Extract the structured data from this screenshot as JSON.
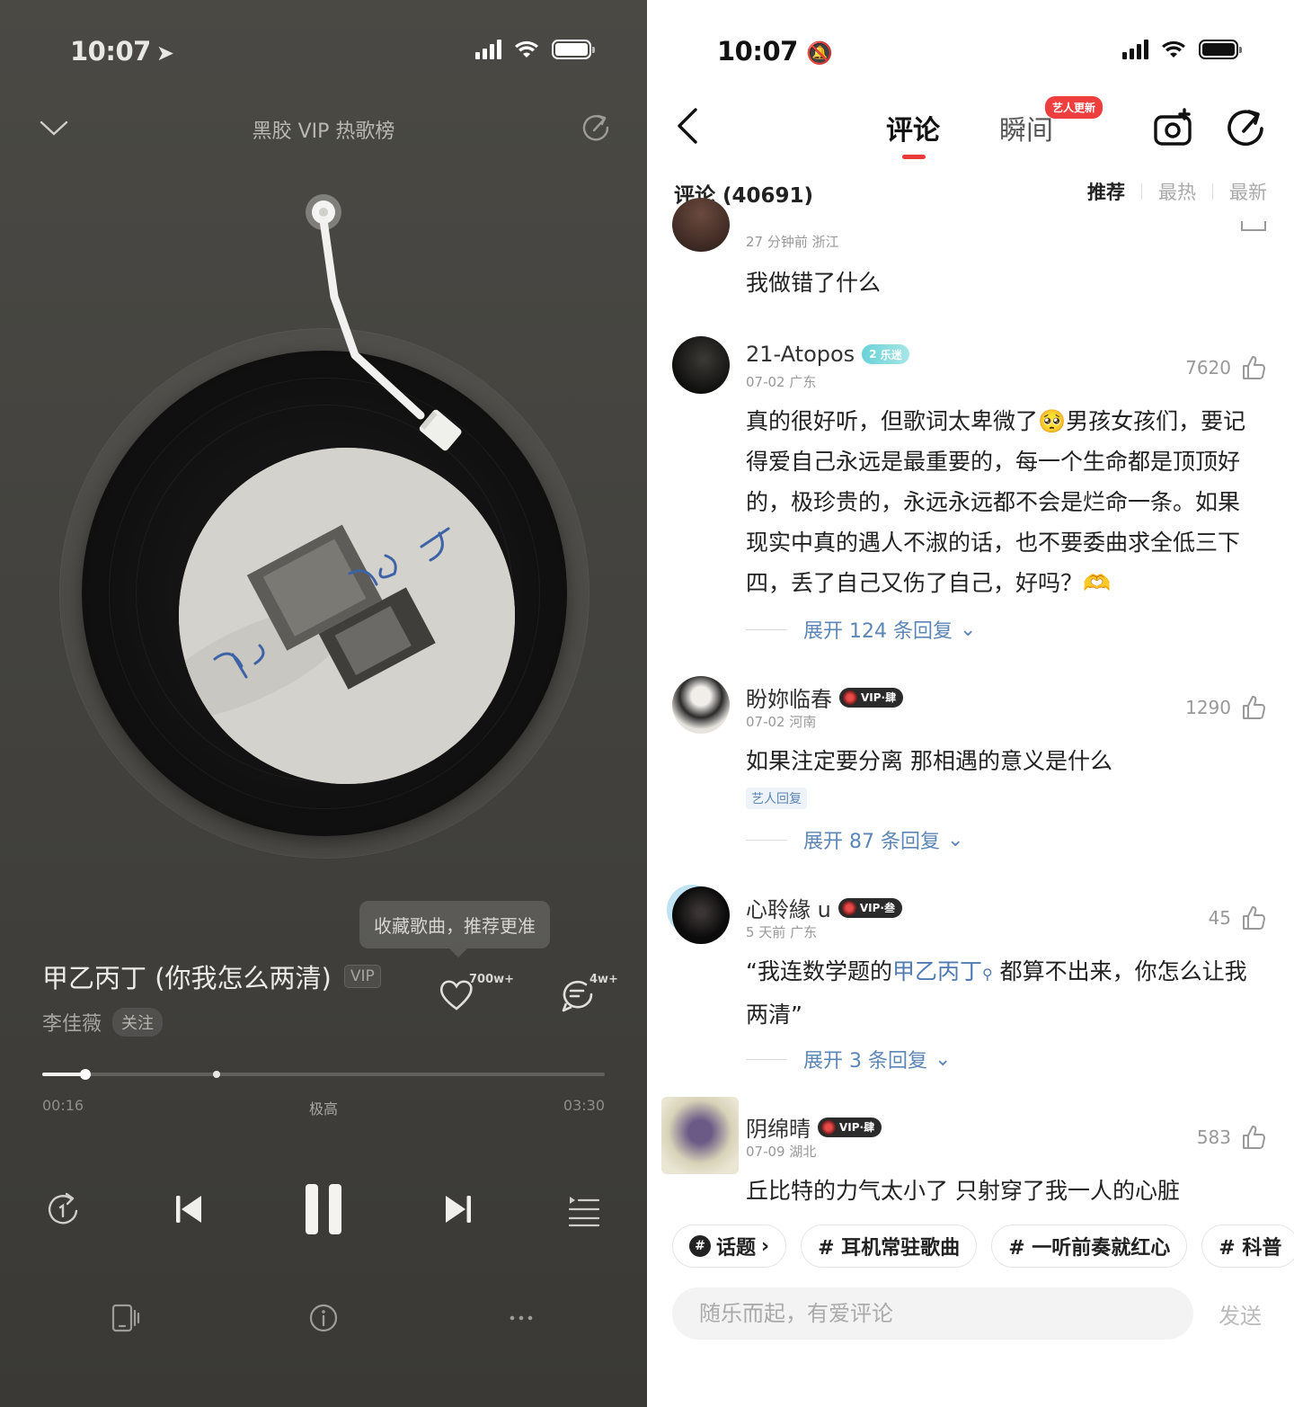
{
  "player": {
    "status": {
      "time": "10:07"
    },
    "header": {
      "title": "黑胶 VIP 热歌榜"
    },
    "tooltip": "收藏歌曲，推荐更准",
    "song": {
      "title": "甲乙丙丁 (你我怎么两清)",
      "vip_badge": "VIP",
      "artist": "李佳薇",
      "follow_label": "关注"
    },
    "like_count": "700w+",
    "comment_count": "4w+",
    "progress": {
      "current": "00:16",
      "total": "03:30",
      "quality": "极高",
      "played_fraction": 0.076,
      "buffered_fraction": 0.31
    },
    "cover_text": "甲乙丙丁",
    "colors": {
      "bg": "#45443f",
      "accent": "#ffffff"
    }
  },
  "comments_page": {
    "status": {
      "time": "10:07"
    },
    "tabs": {
      "active": "评论",
      "other": "瞬间",
      "badge": "艺人更新"
    },
    "header": {
      "count_label": "评论 (40691)",
      "sorts": [
        "推荐",
        "最热",
        "最新"
      ]
    },
    "top_partial": {
      "meta": "27 分钟前 浙江",
      "text": "我做错了什么"
    },
    "items": [
      {
        "user": "21-Atopos",
        "badge": "乐迷",
        "badge_level": "2",
        "meta": "07-02 广东",
        "likes": "7620",
        "text": "真的很好听，但歌词太卑微了🥺男孩女孩们，要记得爱自己永远是最重要的，每一个生命都是顶顶好的，极珍贵的，永远永远都不会是烂命一条。如果现实中真的遇人不淑的话，也不要委曲求全低三下四，丢了自己又伤了自己，好吗？🫶",
        "expand": "展开 124 条回复"
      },
      {
        "user": "盼妳临春",
        "badge": "VIP·肆",
        "meta": "07-02 河南",
        "likes": "1290",
        "text": "如果注定要分离 那相遇的意义是什么",
        "artist_reply": "艺人回复",
        "expand": "展开 87 条回复"
      },
      {
        "user": "心聆緣 u",
        "badge": "VIP·叁",
        "meta": "5 天前 广东",
        "likes": "45",
        "text_pre": "“我连数学题的",
        "text_link": "甲乙丙丁",
        "text_post": " 都算不出来，你怎么让我两清”",
        "expand": "展开 3 条回复"
      },
      {
        "user": "阴绵晴",
        "badge": "VIP·肆",
        "meta": "07-09 湖北",
        "likes": "583",
        "text": "丘比特的力气太小了 只射穿了我一人的心脏"
      }
    ],
    "topics": [
      "话题",
      "# 耳机常驻歌曲",
      "# 一听前奏就红心",
      "# 科普"
    ],
    "input": {
      "placeholder": "随乐而起，有爱评论",
      "send": "发送"
    },
    "colors": {
      "accent_red": "#ea3a3a",
      "link_blue": "#5b86b5"
    }
  }
}
